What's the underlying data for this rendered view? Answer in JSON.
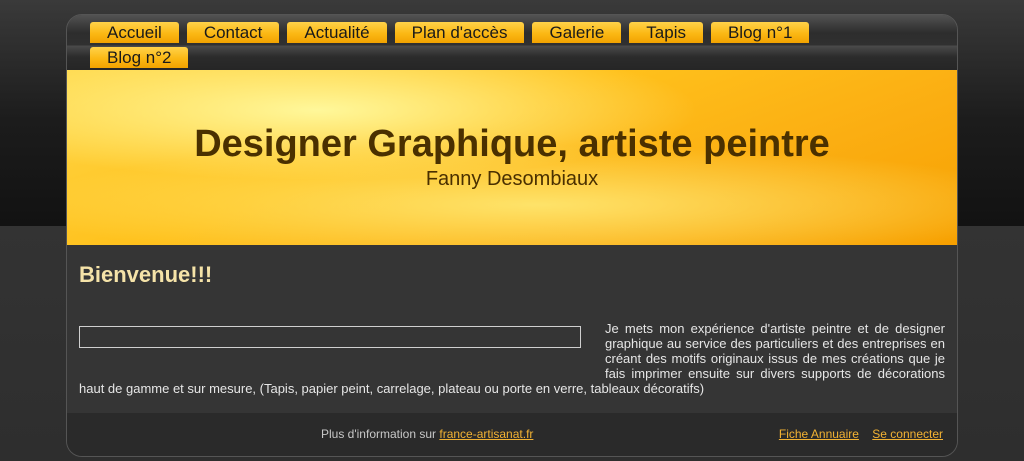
{
  "nav": {
    "items": [
      "Accueil",
      "Contact",
      "Actualité",
      "Plan d'accès",
      "Galerie",
      "Tapis",
      "Blog n°1",
      "Blog n°2"
    ]
  },
  "header": {
    "title": "Designer Graphique, artiste peintre",
    "subtitle": "Fanny Desombiaux"
  },
  "content": {
    "heading": "Bienvenue!!!",
    "intro": "Je mets mon expérience d'artiste peintre et de designer graphique au service des particuliers et des entreprises en créant des motifs originaux issus de mes créations que je fais imprimer ensuite sur divers supports de décorations haut de gamme et sur mesure, (Tapis, papier peint, carrelage, plateau ou porte en verre, tableaux décoratifs)"
  },
  "footer": {
    "info_prefix": "Plus d'information sur",
    "info_link": "france-artisanat.fr",
    "links": [
      "Fiche Annuaire",
      "Se connecter"
    ]
  },
  "colors": {
    "accent": "#fbb814",
    "heading": "#f5e3a8",
    "link": "#f2b233"
  }
}
